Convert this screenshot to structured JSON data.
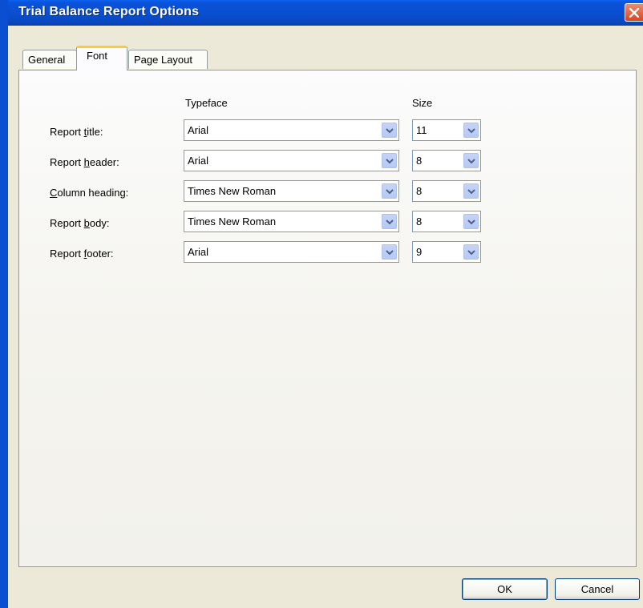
{
  "window": {
    "title": "Trial Balance Report Options"
  },
  "tabs": [
    {
      "label": "General"
    },
    {
      "label": "Font"
    },
    {
      "label": "Page Layout"
    }
  ],
  "columns": {
    "typeface": "Typeface",
    "size": "Size"
  },
  "rows": [
    {
      "label_pre": "Report ",
      "label_key": "t",
      "label_post": "itle:",
      "typeface": "Arial",
      "size": "11"
    },
    {
      "label_pre": "Report ",
      "label_key": "h",
      "label_post": "eader:",
      "typeface": "Arial",
      "size": "8"
    },
    {
      "label_pre": "",
      "label_key": "C",
      "label_post": "olumn heading:",
      "typeface": "Times New Roman",
      "size": "8"
    },
    {
      "label_pre": "Report ",
      "label_key": "b",
      "label_post": "ody:",
      "typeface": "Times New Roman",
      "size": "8"
    },
    {
      "label_pre": "Report ",
      "label_key": "f",
      "label_post": "ooter:",
      "typeface": "Arial",
      "size": "9"
    }
  ],
  "buttons": {
    "ok": "OK",
    "cancel": "Cancel"
  },
  "colors": {
    "titlebar": "#0a4fd1",
    "active_tab_accent": "#ffc83c",
    "close_button": "#d8451f"
  }
}
